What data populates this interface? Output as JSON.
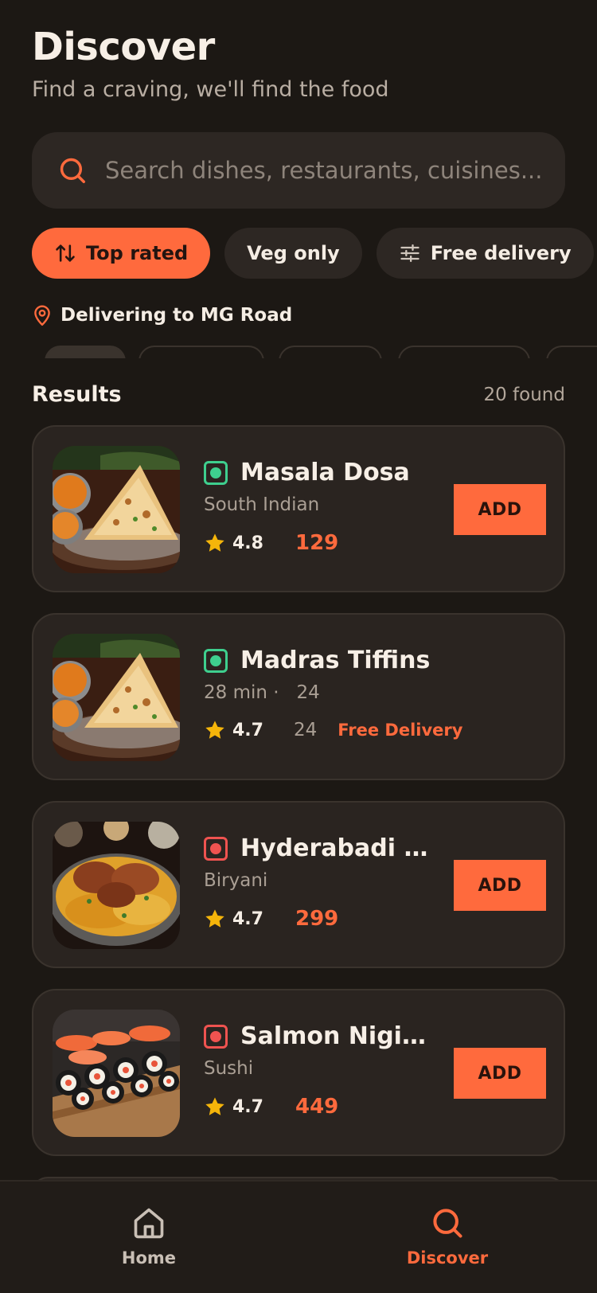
{
  "header": {
    "title": "Discover",
    "subtitle": "Find a craving, we'll find the food"
  },
  "search": {
    "placeholder": "Search dishes, restaurants, cuisines..."
  },
  "filters": [
    {
      "label": "Top rated",
      "icon": "sort-icon",
      "active": true
    },
    {
      "label": "Veg only",
      "active": false
    },
    {
      "label": "Free delivery",
      "icon": "sliders-icon",
      "active": false
    }
  ],
  "location": {
    "text": "Delivering to MG Road",
    "icon": "map-pin-icon"
  },
  "results": {
    "title": "Results",
    "count": "20 found",
    "items": [
      {
        "name": "Masala Dosa",
        "meta": "South Indian",
        "rating": "4.8",
        "price": "129",
        "diet": "veg",
        "action": "ADD",
        "image": "dosa"
      },
      {
        "name": "Madras Tiffins",
        "meta": "28 min ·   24",
        "rating": "4.7",
        "extra": "24",
        "badge": "Free Delivery",
        "diet": "veg",
        "image": "dosa"
      },
      {
        "name": "Hyderabadi C...",
        "meta": "Biryani",
        "rating": "4.7",
        "price": "299",
        "diet": "non-veg",
        "action": "ADD",
        "image": "biryani"
      },
      {
        "name": "Salmon Nigiri ...",
        "meta": "Sushi",
        "rating": "4.7",
        "price": "449",
        "diet": "non-veg",
        "action": "ADD",
        "image": "sushi"
      }
    ]
  },
  "tabs": [
    {
      "label": "Home",
      "icon": "home-icon",
      "active": false
    },
    {
      "label": "Discover",
      "icon": "search-icon",
      "active": true
    }
  ],
  "colors": {
    "accent": "#ff6a3d",
    "background": "#1c1814",
    "card": "#2a2420",
    "veg": "#3ecf8e",
    "nonveg": "#ef5350",
    "star": "#f5b50a"
  }
}
